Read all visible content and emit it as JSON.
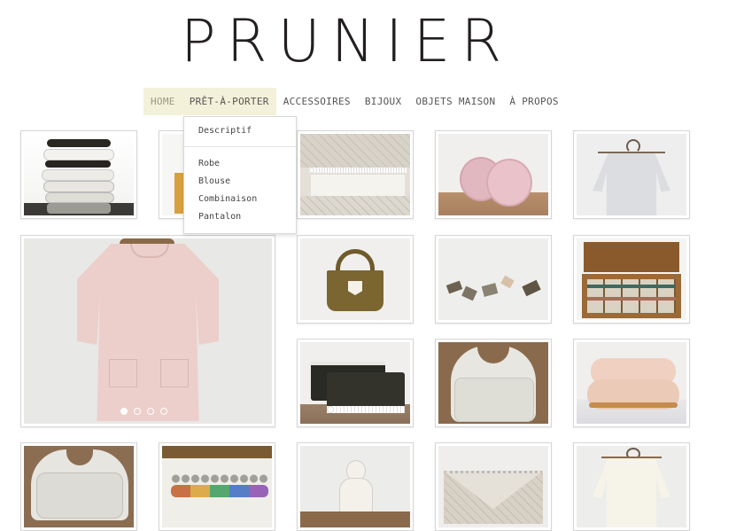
{
  "brand": {
    "logo": "PRUNIER"
  },
  "nav": {
    "items": [
      {
        "label": "HOME"
      },
      {
        "label": "PRÊT-À-PORTER"
      },
      {
        "label": "ACCESSOIRES"
      },
      {
        "label": "BIJOUX"
      },
      {
        "label": "OBJETS MAISON"
      },
      {
        "label": "À PROPOS"
      }
    ],
    "active_index": 1
  },
  "dropdown": {
    "header": "Descriptif",
    "items": [
      "Robe",
      "Blouse",
      "Combinaison",
      "Pantalon"
    ]
  },
  "gallery": {
    "slider": {
      "slide_count": 4,
      "active_slide": 1
    },
    "items": [
      {
        "icon": "stacked-cushions"
      },
      {
        "icon": "tote-bag-partial"
      },
      {
        "icon": "quilted-pouch-lace"
      },
      {
        "icon": "pink-round-purses"
      },
      {
        "icon": "grey-blouse-on-hanger"
      },
      {
        "icon": "pink-dress-on-hanger"
      },
      {
        "icon": "olive-tote-bag"
      },
      {
        "icon": "paper-origami-mobile"
      },
      {
        "icon": "wooden-box-with-ribbons"
      },
      {
        "icon": "black-pouches"
      },
      {
        "icon": "white-bibs"
      },
      {
        "icon": "peach-pillows"
      },
      {
        "icon": "white-bibs-stack"
      },
      {
        "icon": "colored-beads-tray"
      },
      {
        "icon": "white-doll"
      },
      {
        "icon": "quilted-envelope-lace"
      },
      {
        "icon": "cream-blouse-on-hanger"
      }
    ]
  }
}
